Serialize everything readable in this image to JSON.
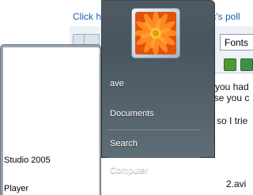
{
  "background_page": {
    "poll_link_text": "Click here to",
    "poll_link_tail": "is topic's poll",
    "fonts_select_value": "Fonts",
    "post_lines": [
      "you had",
      "ase you c",
      "so I trie",
      "2.avi"
    ]
  },
  "start_menu": {
    "programs": [
      {
        "label": "Studio 2005"
      },
      {
        "label": "Player"
      }
    ],
    "right_items": [
      {
        "label": "ave"
      },
      {
        "label": "Documents"
      },
      {
        "label": "Search"
      },
      {
        "label": "Computer"
      }
    ],
    "user_picture_icon": "orange-gerbera-flower-icon"
  },
  "colors": {
    "link": "#1a5fb4",
    "start_menu_right_pane": "#4a5862",
    "flower_orange": "#f26b0a"
  }
}
